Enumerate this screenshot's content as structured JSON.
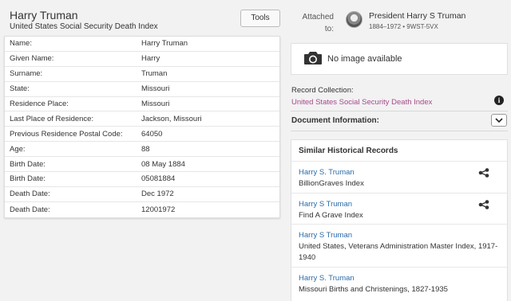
{
  "record": {
    "title": "Harry Truman",
    "collection": "United States Social Security Death Index",
    "tools_label": "Tools"
  },
  "facts": [
    {
      "label": "Name:",
      "value": "Harry Truman"
    },
    {
      "label": "Given Name:",
      "value": "Harry"
    },
    {
      "label": "Surname:",
      "value": "Truman"
    },
    {
      "label": "State:",
      "value": "Missouri"
    },
    {
      "label": "Residence Place:",
      "value": "Missouri"
    },
    {
      "label": "Last Place of Residence:",
      "value": "Jackson, Missouri"
    },
    {
      "label": "Previous Residence Postal Code:",
      "value": "64050"
    },
    {
      "label": "Age:",
      "value": "88"
    },
    {
      "label": "Birth Date:",
      "value": "08 May 1884"
    },
    {
      "label": "Birth Date:",
      "value": "05081884"
    },
    {
      "label": "Death Date:",
      "value": "Dec 1972"
    },
    {
      "label": "Death Date:",
      "value": "12001972"
    }
  ],
  "attached": {
    "label_line1": "Attached",
    "label_line2": "to:",
    "person_name": "President Harry S Truman",
    "person_meta": "1884–1972 • 9WST-5VX"
  },
  "image": {
    "no_image_text": "No image available",
    "icon": "camera-icon"
  },
  "record_collection": {
    "label": "Record Collection:",
    "link": "United States Social Security Death Index",
    "icon": "info-icon",
    "icon_glyph": "i"
  },
  "document_info": {
    "label": "Document Information:",
    "icon": "chevron-down-icon"
  },
  "similar": {
    "heading": "Similar Historical Records",
    "items": [
      {
        "name": "Harry S. Truman",
        "collection": "BillionGraves Index",
        "has_tree_icon": true
      },
      {
        "name": "Harry S Truman",
        "collection": "Find A Grave Index",
        "has_tree_icon": true
      },
      {
        "name": "Harry S Truman",
        "collection": "United States, Veterans Administration Master Index, 1917-1940",
        "has_tree_icon": false
      },
      {
        "name": "Harry S. Truman",
        "collection": "Missouri Births and Christenings, 1827-1935",
        "has_tree_icon": false
      }
    ]
  },
  "colors": {
    "link_blue": "#2b6aa8",
    "collection_link": "#a54a8c",
    "background": "#f2f2f2"
  }
}
